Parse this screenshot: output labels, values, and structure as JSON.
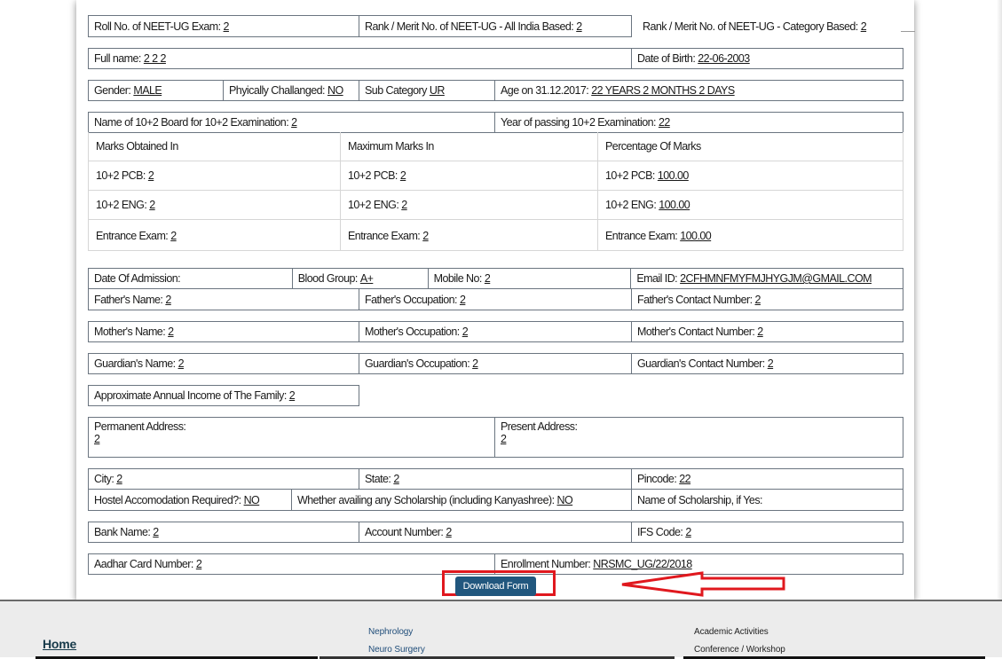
{
  "form": {
    "roll_label": "Roll No. of NEET-UG Exam:",
    "roll_value": "2",
    "rank_all_label": "Rank / Merit No. of NEET-UG - All India Based:",
    "rank_all_value": "2",
    "rank_cat_label": "Rank / Merit No. of NEET-UG - Category Based:",
    "rank_cat_value": "2",
    "full_name_label": "Full name:",
    "full_name_value": "2 2 2",
    "dob_label": "Date of Birth:",
    "dob_value": "22-06-2003",
    "gender_label": "Gender:",
    "gender_value": "MALE",
    "challenged_label": "Phyically Challanged:",
    "challenged_value": "NO",
    "subcat_label": "Sub Category",
    "subcat_value": "UR",
    "age_label": "Age on 31.12.2017:",
    "age_value": "22 YEARS 2 MONTHS 2 DAYS",
    "board_label": "Name of 10+2 Board for 10+2 Examination:",
    "board_value": "2",
    "year_label": "Year of passing 10+2 Examination:",
    "year_value": "22",
    "marks_headers": [
      "Marks Obtained In",
      "Maximum Marks In",
      "Percentage Of Marks"
    ],
    "marks_rows": [
      [
        {
          "label": "10+2 PCB:",
          "value": "2"
        },
        {
          "label": "10+2 PCB:",
          "value": "2"
        },
        {
          "label": "10+2 PCB:",
          "value": "100.00"
        }
      ],
      [
        {
          "label": "10+2 ENG:",
          "value": "2"
        },
        {
          "label": "10+2 ENG:",
          "value": "2"
        },
        {
          "label": "10+2 ENG:",
          "value": "100.00"
        }
      ],
      [
        {
          "label": "Entrance Exam:",
          "value": "2"
        },
        {
          "label": "Entrance Exam:",
          "value": "2"
        },
        {
          "label": "Entrance Exam:",
          "value": "100.00"
        }
      ]
    ],
    "admission_label": "Date Of Admission:",
    "admission_value": "",
    "blood_label": "Blood Group:",
    "blood_value": "A+",
    "mobile_label": "Mobile No:",
    "mobile_value": "2",
    "email_label": "Email ID:",
    "email_value": "2CFHMNFMYFMJHYGJM@GMAIL.COM",
    "father_name_label": "Father's Name:",
    "father_name_value": "2",
    "father_occ_label": "Father's Occupation:",
    "father_occ_value": "2",
    "father_contact_label": "Father's Contact Number:",
    "father_contact_value": "2",
    "mother_name_label": "Mother's Name:",
    "mother_name_value": "2",
    "mother_occ_label": "Mother's Occupation:",
    "mother_occ_value": "2",
    "mother_contact_label": "Mother's Contact Number:",
    "mother_contact_value": "2",
    "guardian_name_label": "Guardian's Name:",
    "guardian_name_value": "2",
    "guardian_occ_label": "Guardian's Occupation:",
    "guardian_occ_value": "2",
    "guardian_contact_label": "Guardian's Contact Number:",
    "guardian_contact_value": "2",
    "income_label": "Approximate Annual Income of The Family:",
    "income_value": "2",
    "perm_addr_label": "Permanent Address:",
    "perm_addr_value": "2",
    "pres_addr_label": "Present Address:",
    "pres_addr_value": "2",
    "city_label": "City:",
    "city_value": "2",
    "state_label": "State:",
    "state_value": "2",
    "pincode_label": "Pincode:",
    "pincode_value": "22",
    "hostel_label": "Hostel Accomodation Required?:",
    "hostel_value": "NO",
    "scholarship_label": "Whether availing any Scholarship (including Kanyashree):",
    "scholarship_value": "NO",
    "scholarship_name_label": "Name of Scholarship, if Yes:",
    "scholarship_name_value": "",
    "bank_label": "Bank Name:",
    "bank_value": "2",
    "account_label": "Account Number:",
    "account_value": "2",
    "ifs_label": "IFS Code:",
    "ifs_value": "2",
    "aadhar_label": "Aadhar Card Number:",
    "aadhar_value": "2",
    "enroll_label": "Enrollment Number:",
    "enroll_value": "NRSMC_UG/22/2018"
  },
  "download_button": "Download Form",
  "footer": {
    "home": "Home",
    "col2": [
      "Nephrology",
      "Neuro Surgery"
    ],
    "col3": [
      "Academic Activities",
      "Conference / Workshop"
    ]
  },
  "colors": {
    "button": "#21577e",
    "highlight": "#e0181e",
    "link": "#214e7a"
  }
}
